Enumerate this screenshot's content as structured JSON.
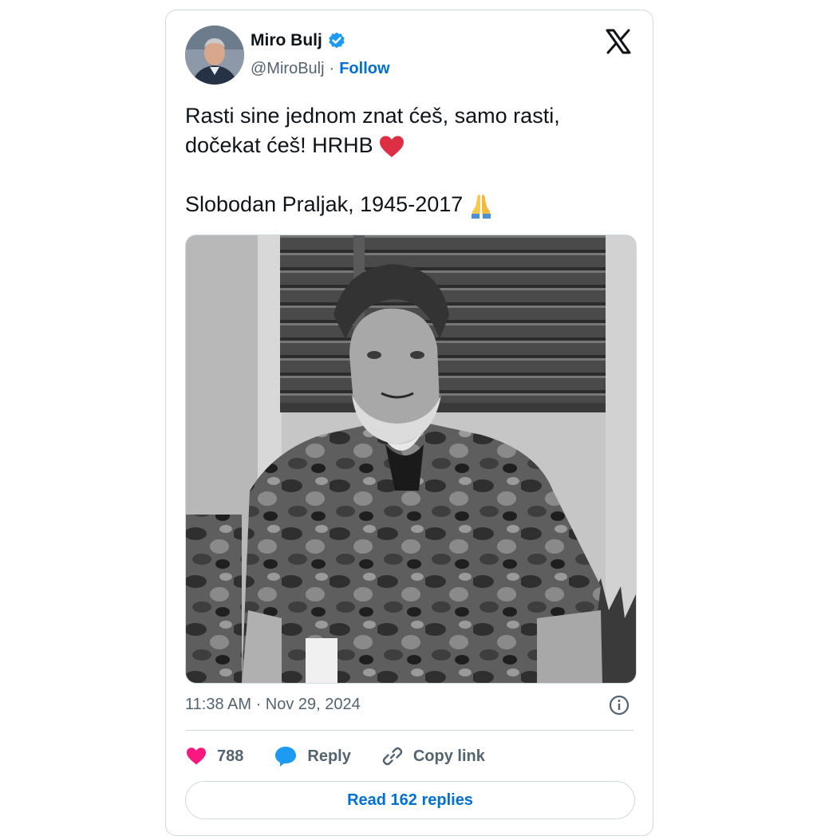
{
  "author": {
    "name": "Miro Bulj",
    "handle": "@MiroBulj",
    "separator": "·",
    "follow_label": "Follow",
    "verified_icon": "verified-badge-icon"
  },
  "platform_icon": "x-logo-icon",
  "tweet": {
    "line1": "Rasti sine jednom znat ćeš, samo rasti,",
    "line2": "dočekat ćeš! HRHB",
    "line2_emoji": "red-heart-icon",
    "line3": "Slobodan Praljak, 1945-2017",
    "line3_emoji": "folded-hands-icon"
  },
  "photo": {
    "type": "black-and-white photo of bearded man in camouflage jacket"
  },
  "timestamp": "11:38 AM · Nov 29, 2024",
  "actions": {
    "likes_count": "788",
    "reply_label": "Reply",
    "copy_link_label": "Copy link"
  },
  "read_replies_label": "Read 162 replies",
  "colors": {
    "accent": "#006fd6",
    "heart": "#f91880",
    "reply_bubble": "#1d9bf0",
    "secondary_text": "#536471",
    "border": "#cfd9de"
  }
}
